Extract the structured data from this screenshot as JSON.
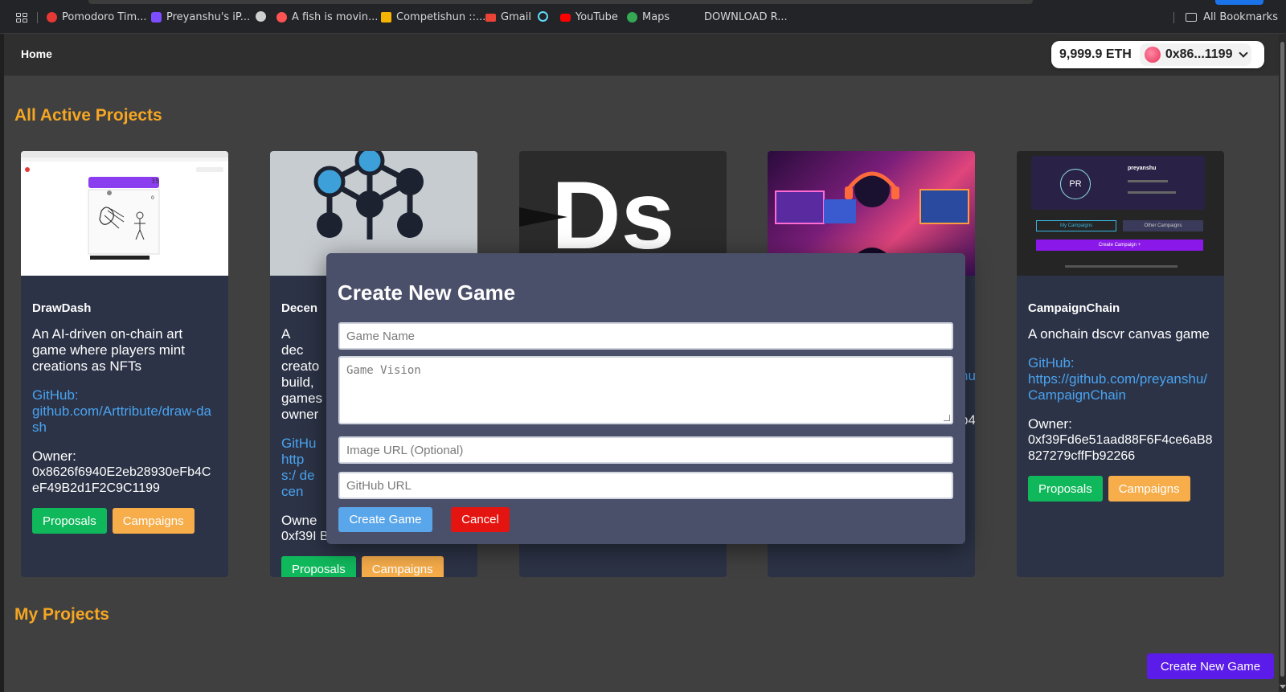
{
  "bookmarks": {
    "items": [
      {
        "label": "Pomodoro Tim...",
        "color": "#e53935"
      },
      {
        "label": "Preyanshu's iP...",
        "color": "#7c4dff"
      },
      {
        "label": "",
        "color": "#cfcfcf"
      },
      {
        "label": "A fish is movin...",
        "color": "#ff5252"
      },
      {
        "label": "Competishun ::...",
        "color": "#f5b400"
      },
      {
        "label": "Gmail",
        "color": "#ea4335"
      },
      {
        "label": "",
        "color": "#61dafb"
      },
      {
        "label": "YouTube",
        "color": "#ff0000"
      },
      {
        "label": "Maps",
        "color": "#34a853"
      },
      {
        "label": "DOWNLOAD R...",
        "color": ""
      }
    ],
    "all_bookmarks": "All Bookmarks"
  },
  "nav": {
    "home": "Home",
    "wallet_balance": "9,999.9 ETH",
    "wallet_address": "0x86...1199"
  },
  "sections": {
    "active": "All Active Projects",
    "mine": "My Projects"
  },
  "cards": [
    {
      "name": "DrawDash",
      "description": "An AI-driven on-chain art game where players mint creations as NFTs",
      "github_label": "GitHub:",
      "github": "github.com/Arttribute/draw-dash",
      "owner_label": "Owner:",
      "owner": "0x8626f6940E2eb28930eFb4CeF49B2d1F2C9C1199",
      "proposals": "Proposals",
      "campaigns": "Campaigns"
    },
    {
      "name": "Decen",
      "description": "A dec creato build, games owner",
      "github_label": "GitHu",
      "github": "https:/ decen",
      "owner_label": "Owne",
      "owner": "0xf39I B8827279cffFb92266",
      "proposals": "Proposals",
      "campaigns": "Campaigns"
    },
    {
      "thumb_text": "Ds"
    },
    {
      "partial_link": "nu",
      "partial_owner": "b4"
    },
    {
      "name": "CampaignChain",
      "description": "A onchain dscvr canvas game",
      "github_label": "GitHub:",
      "github": "https://github.com/preyanshu/CampaignChain",
      "owner_label": "Owner:",
      "owner": "0xf39Fd6e51aad88F6F4ce6aB8827279cffFb92266",
      "proposals": "Proposals",
      "campaigns": "Campaigns",
      "thumb": {
        "avatar": "PR",
        "user": "preyanshu",
        "tab1": "My Campaigns",
        "tab2": "Other Campaigns",
        "cta": "Create Campaign +"
      }
    }
  ],
  "modal": {
    "title": "Create New Game",
    "game_name_placeholder": "Game Name",
    "game_vision_placeholder": "Game Vision",
    "image_url_placeholder": "Image URL (Optional)",
    "github_url_placeholder": "GitHub URL",
    "create": "Create Game",
    "cancel": "Cancel"
  },
  "create_new_game": "Create New Game",
  "colors": {
    "accent_orange": "#f5a623",
    "card_bg": "#2c3346",
    "modal_bg": "#4a4f6a",
    "link_blue": "#4aa3f0",
    "green": "#10b85c",
    "purple": "#5b1be8",
    "red": "#e41410"
  }
}
